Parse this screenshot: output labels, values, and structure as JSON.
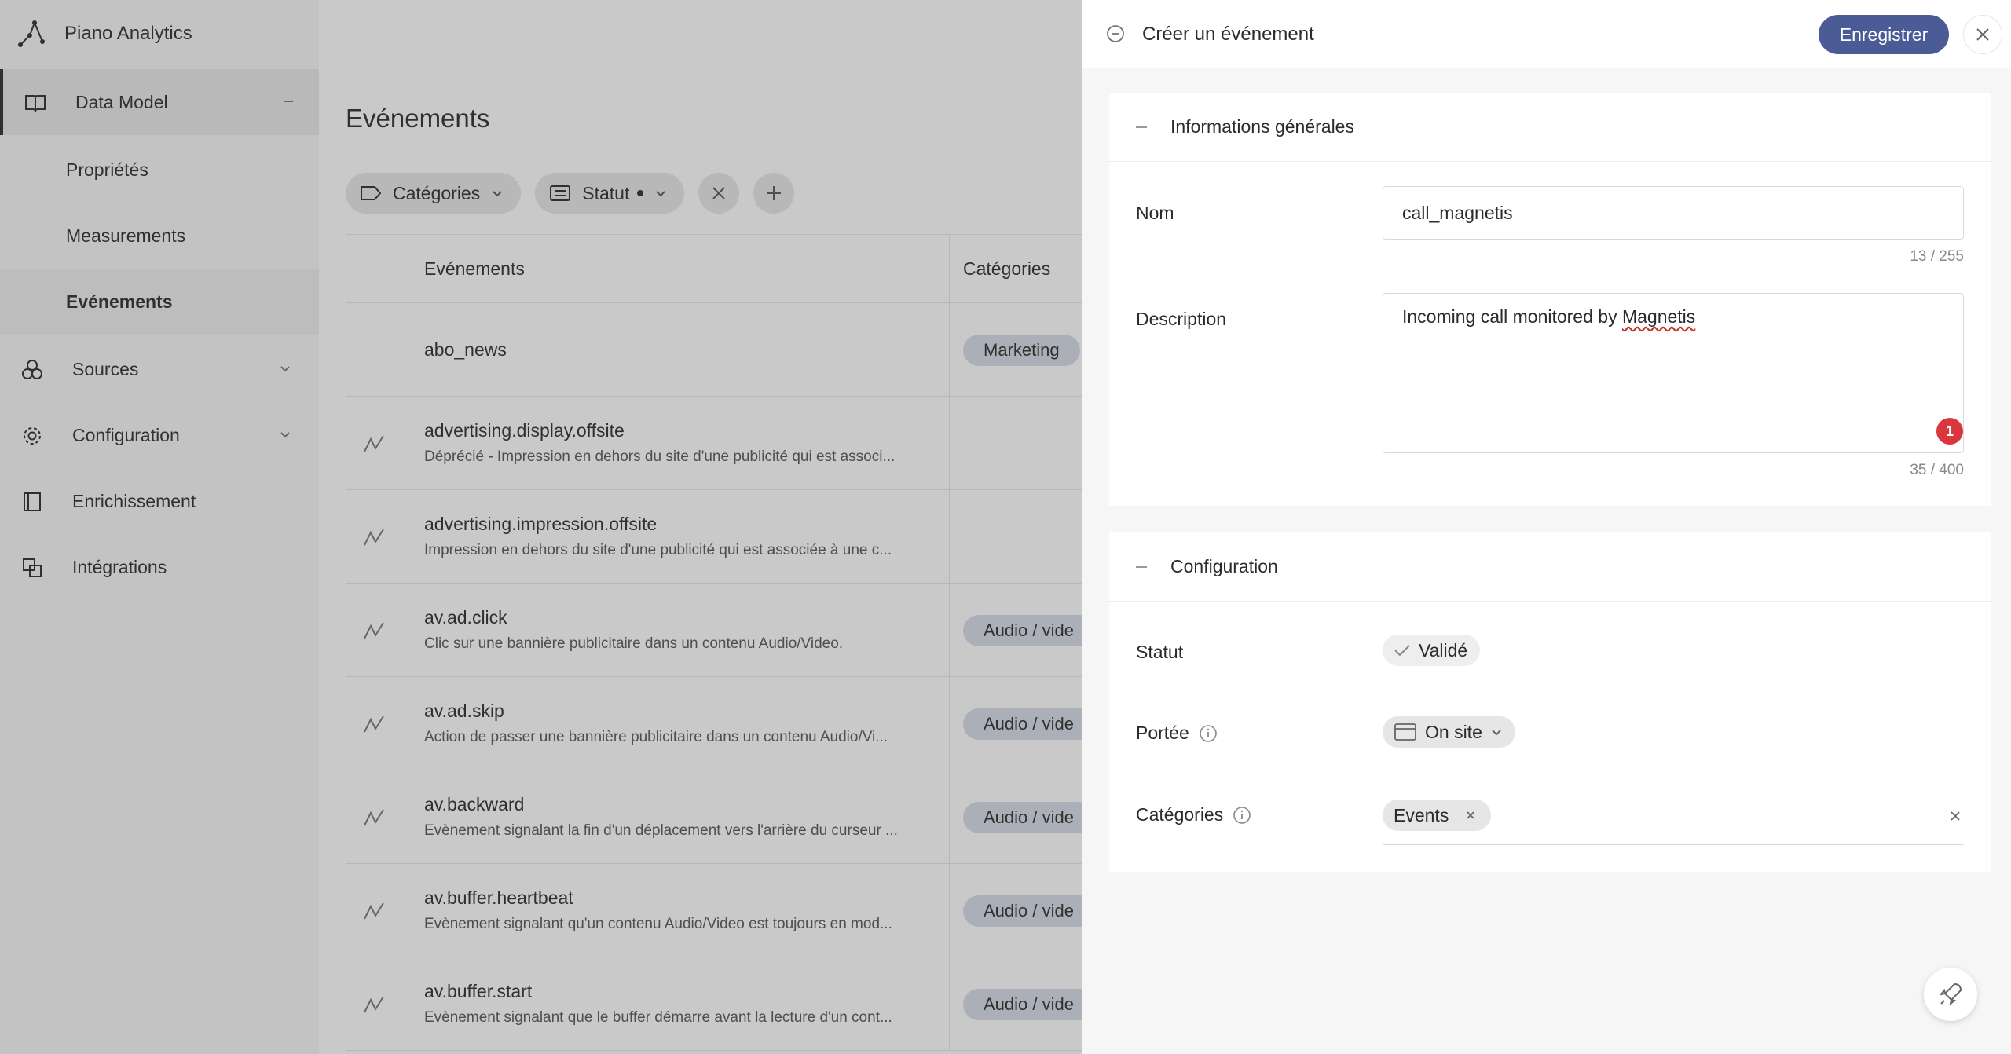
{
  "app": {
    "name": "Piano Analytics"
  },
  "sidebar": {
    "items": [
      {
        "label": "Data Model",
        "icon": "book-icon"
      },
      {
        "label": "Propriétés"
      },
      {
        "label": "Measurements"
      },
      {
        "label": "Evénements"
      },
      {
        "label": "Sources",
        "icon": "sources-icon"
      },
      {
        "label": "Configuration",
        "icon": "gear-icon"
      },
      {
        "label": "Enrichissement",
        "icon": "enrich-icon"
      },
      {
        "label": "Intégrations",
        "icon": "integrations-icon"
      }
    ]
  },
  "main": {
    "title": "Evénements",
    "filters": {
      "categories": "Catégories",
      "status": "Statut"
    },
    "table": {
      "headers": [
        "Evénements",
        "Catégories"
      ],
      "rows": [
        {
          "name": "abo_news",
          "desc": "",
          "category": "Marketing"
        },
        {
          "name": "advertising.display.offsite",
          "desc": "Déprécié - Impression en dehors du site d'une publicité qui est associ...",
          "category": ""
        },
        {
          "name": "advertising.impression.offsite",
          "desc": "Impression en dehors du site d'une publicité qui est associée à une c...",
          "category": ""
        },
        {
          "name": "av.ad.click",
          "desc": "Clic sur une bannière publicitaire dans un contenu Audio/Video.",
          "category": "Audio / vide"
        },
        {
          "name": "av.ad.skip",
          "desc": "Action de passer une bannière publicitaire dans un contenu Audio/Vi...",
          "category": "Audio / vide"
        },
        {
          "name": "av.backward",
          "desc": "Evènement signalant la fin d'un déplacement vers l'arrière du curseur ...",
          "category": "Audio / vide"
        },
        {
          "name": "av.buffer.heartbeat",
          "desc": "Evènement signalant qu'un contenu Audio/Video est toujours en mod...",
          "category": "Audio / vide"
        },
        {
          "name": "av.buffer.start",
          "desc": "Evènement signalant que le buffer démarre avant la lecture d'un cont...",
          "category": "Audio / vide"
        }
      ]
    }
  },
  "drawer": {
    "title": "Créer un événement",
    "save_label": "Enregistrer",
    "general": {
      "title": "Informations générales",
      "name_label": "Nom",
      "name_value": "call_magnetis",
      "name_counter": "13 / 255",
      "description_label": "Description",
      "description_prefix": "Incoming call monitored by ",
      "description_flagged_word": "Magnetis",
      "description_counter": "35 / 400",
      "error_count": "1"
    },
    "config": {
      "title": "Configuration",
      "status_label": "Statut",
      "status_value": "Validé",
      "scope_label": "Portée",
      "scope_value": "On site",
      "categories_label": "Catégories",
      "category_tag": "Events"
    }
  },
  "colors": {
    "primary_button": "#4a5b95",
    "error_badge": "#d9363e",
    "category_pill": "#d6dbe6"
  }
}
